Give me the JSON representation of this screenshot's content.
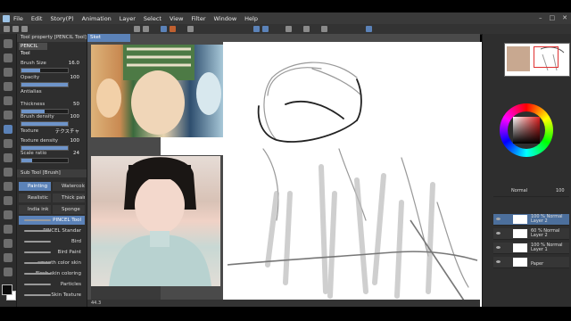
{
  "menu": [
    "File",
    "Edit",
    "Story(P)",
    "Animation",
    "Layer",
    "Select",
    "View",
    "Filter",
    "Window",
    "Help"
  ],
  "canvas_tab": "Sket",
  "tool_property": {
    "tab": "Tool property [PENCIL Tool]",
    "tool_name": "PENCIL Tool",
    "brush_size_label": "Brush Size",
    "brush_size": "16.0",
    "opacity_label": "Opacity",
    "opacity": "100",
    "antialias_label": "Antialias",
    "thickness_label": "Thickness",
    "thickness": "50",
    "brush_density_label": "Brush density",
    "brush_density": "100",
    "texture_label": "Texture",
    "texture_value": "テクスチャ",
    "texture_density_label": "Texture density",
    "texture_density": "100",
    "scale_ratio_label": "Scale ratio",
    "scale_ratio": "24"
  },
  "sub_tool": {
    "tab": "Sub Tool [Brush]",
    "groups": [
      "Painting",
      "Watercolor",
      "Realistic",
      "Thick paint",
      "India ink",
      "Sponge"
    ],
    "brushes": [
      "PINCEL Tool",
      "PINCEL Standar",
      "Bird",
      "Bird Paint",
      "smooth color skin",
      "Flesh skin coloring",
      "Particles",
      "Skin Texture"
    ]
  },
  "status": {
    "zoom": "44.3"
  },
  "layers": {
    "blend": "Normal",
    "opacity": "100",
    "items": [
      {
        "line1": "100 % Normal",
        "line2": "Layer 2",
        "selected": true
      },
      {
        "line1": "60 % Normal",
        "line2": "Layer 2",
        "selected": false
      },
      {
        "line1": "100 % Normal",
        "line2": "Layer 1",
        "selected": false
      },
      {
        "line1": "",
        "line2": "Paper",
        "selected": false
      }
    ]
  },
  "colors": {
    "accent": "#5b82b8",
    "main_color": "#0a0a0a",
    "sub_color": "#ffffff"
  }
}
